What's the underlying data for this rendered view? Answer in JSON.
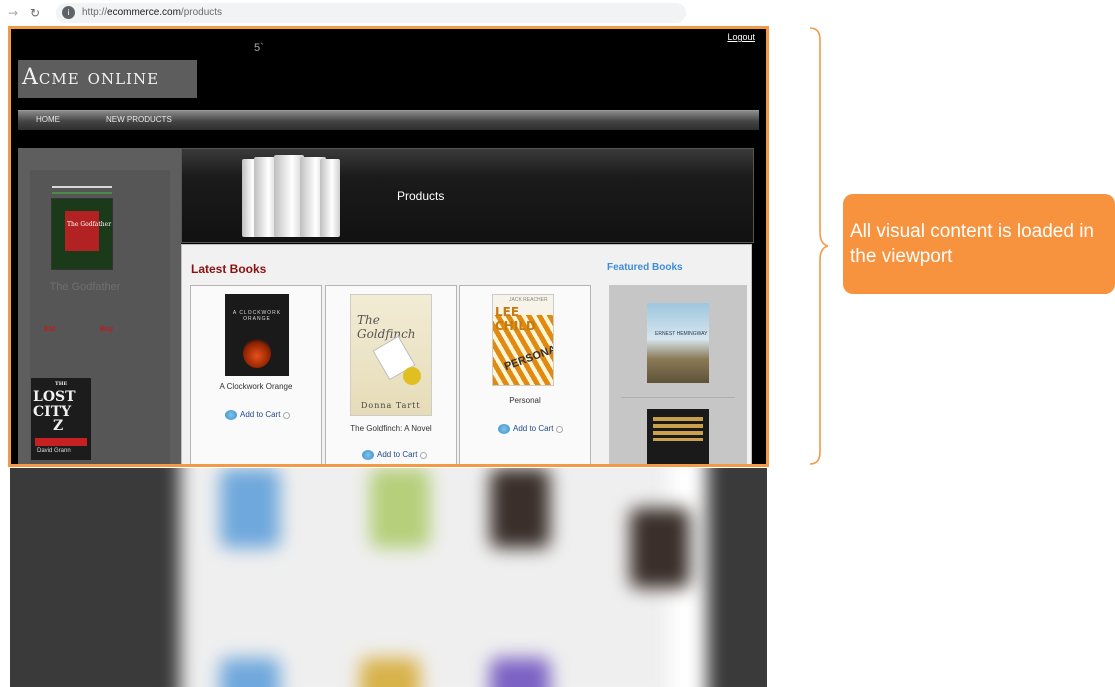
{
  "browser": {
    "back_icon": "back-arrow-icon",
    "reload_icon": "reload-icon",
    "url_prefix": "http://",
    "url_host": "ecommerce.com",
    "url_path": "/products"
  },
  "site": {
    "logout_label": "Logout",
    "stray_mark": "5`",
    "logo_text": "Acme online",
    "nav": {
      "home": "HOME",
      "new_products": "NEW PRODUCTS"
    },
    "sidebar": {
      "book_1": {
        "title": "The Godfather",
        "price": "$10",
        "buy": "Buy",
        "cover_text": "The Godfather"
      },
      "book_2": {
        "cover_lines": [
          "LOST",
          "CITY",
          "Z"
        ],
        "cover_small": "THE",
        "cover_author": "David Grann"
      }
    },
    "banner": {
      "title": "Products"
    },
    "latest_books": {
      "heading": "Latest Books",
      "items": [
        {
          "title": "A Clockwork Orange",
          "add_to_cart": "Add to Cart",
          "cover_text": "A CLOCKWORK ORANGE"
        },
        {
          "title": "The Goldfinch: A Novel",
          "add_to_cart": "Add to Cart",
          "cover_title": "The Goldfinch",
          "cover_author": "Donna Tartt"
        },
        {
          "title": "Personal",
          "add_to_cart": "Add to Cart",
          "cover_author": "LEE CHILD",
          "cover_title": "PERSONAL",
          "cover_small": "JACK REACHER"
        }
      ]
    },
    "featured_books": {
      "heading": "Featured Books",
      "item_1_cover_text": "ERNEST HEMINGWAY"
    }
  },
  "callout": {
    "text": "All visual content is loaded in the viewport"
  },
  "colors": {
    "highlight": "#f39a47",
    "callout_bg": "#f7933e",
    "latest_heading": "#8b1111",
    "featured_heading": "#3b8ed8"
  }
}
